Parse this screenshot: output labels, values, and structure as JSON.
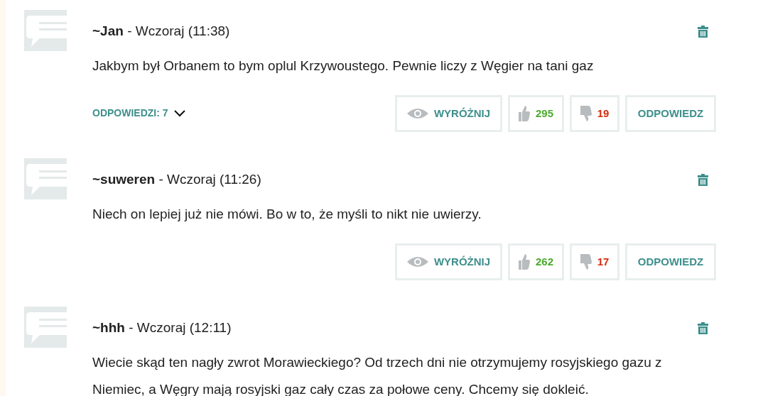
{
  "comments": [
    {
      "author": "~Jan",
      "date": "- Wczoraj (11:38)",
      "text": "Jakbym był Orbanem to bym oplul Krzywoustego. Pewnie liczy z Węgier na tani gaz",
      "replies": "ODPOWIEDZI: 7",
      "actions": {
        "highlight": "WYRÓŻNIJ",
        "likes": "295",
        "dislikes": "19",
        "reply": "ODPOWIEDZ"
      }
    },
    {
      "author": "~suweren",
      "date": "- Wczoraj (11:26)",
      "text": "Niech on lepiej już nie mówi. Bo w to, że myśli to nikt nie uwierzy.",
      "actions": {
        "highlight": "WYRÓŻNIJ",
        "likes": "262",
        "dislikes": "17",
        "reply": "ODPOWIEDZ"
      }
    },
    {
      "author": "~hhh",
      "date": "- Wczoraj (12:11)",
      "text": "Wiecie skąd ten nagły zwrot Morawieckiego? Od trzech dni nie otrzymujemy rosyjskiego gazu z Niemiec, a Węgry mają rosyjski gaz cały czas za połowe ceny. Chcemy się dokleić."
    }
  ]
}
